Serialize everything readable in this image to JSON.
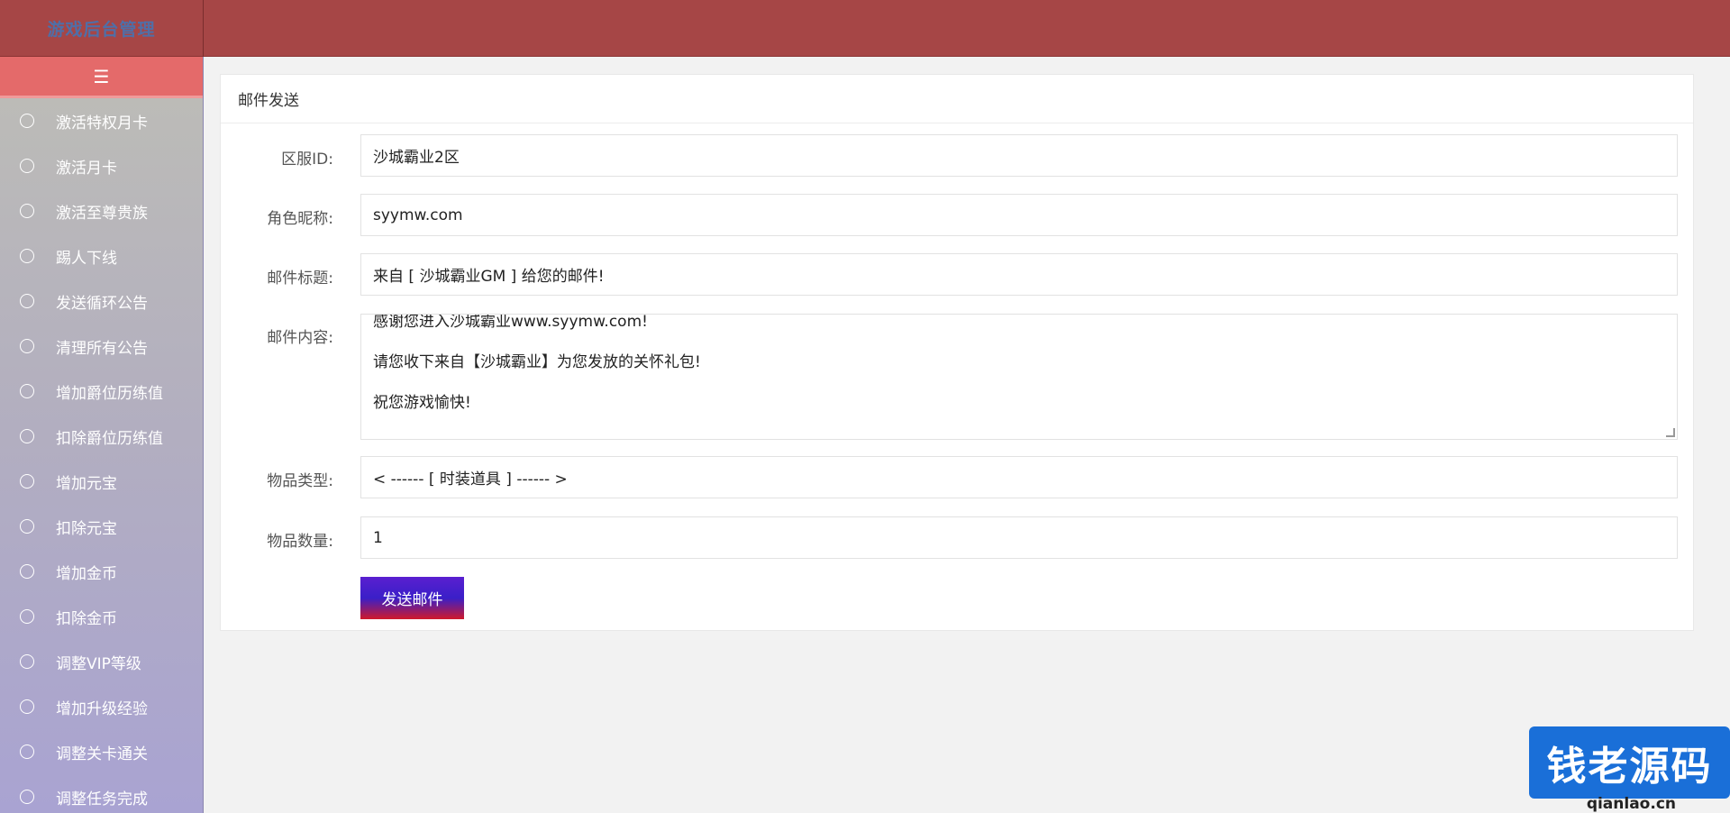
{
  "header": {
    "logo_text": "游戏后台管理"
  },
  "sidebar": {
    "toggle_icon": "menu-collapse-icon",
    "items": [
      {
        "label": "激活特权月卡"
      },
      {
        "label": "激活月卡"
      },
      {
        "label": "激活至尊贵族"
      },
      {
        "label": "踢人下线"
      },
      {
        "label": "发送循环公告"
      },
      {
        "label": "清理所有公告"
      },
      {
        "label": "增加爵位历练值"
      },
      {
        "label": "扣除爵位历练值"
      },
      {
        "label": "增加元宝"
      },
      {
        "label": "扣除元宝"
      },
      {
        "label": "增加金币"
      },
      {
        "label": "扣除金币"
      },
      {
        "label": "调整VIP等级"
      },
      {
        "label": "增加升级经验"
      },
      {
        "label": "调整关卡通关"
      },
      {
        "label": "调整任务完成"
      }
    ]
  },
  "card": {
    "title": "邮件发送",
    "fields": {
      "server": {
        "label": "区服ID:",
        "value": "沙城霸业2区"
      },
      "nickname": {
        "label": "角色昵称:",
        "value": "syymw.com"
      },
      "subject": {
        "label": "邮件标题:",
        "value": "来自 [ 沙城霸业GM ] 给您的邮件!"
      },
      "content": {
        "label": "邮件内容:",
        "lines": [
          "感谢您进入沙城霸业www.syymw.com!",
          "请您收下来自【沙城霸业】为您发放的关怀礼包!",
          "祝您游戏愉快!"
        ]
      },
      "item_type": {
        "label": "物品类型:",
        "value": "< ------ [ 时装道具 ] ------ >"
      },
      "item_count": {
        "label": "物品数量:",
        "value": "1"
      }
    },
    "send_label": "发送邮件"
  },
  "watermark": {
    "text": "钱老源码",
    "url": "qianlao.cn"
  }
}
